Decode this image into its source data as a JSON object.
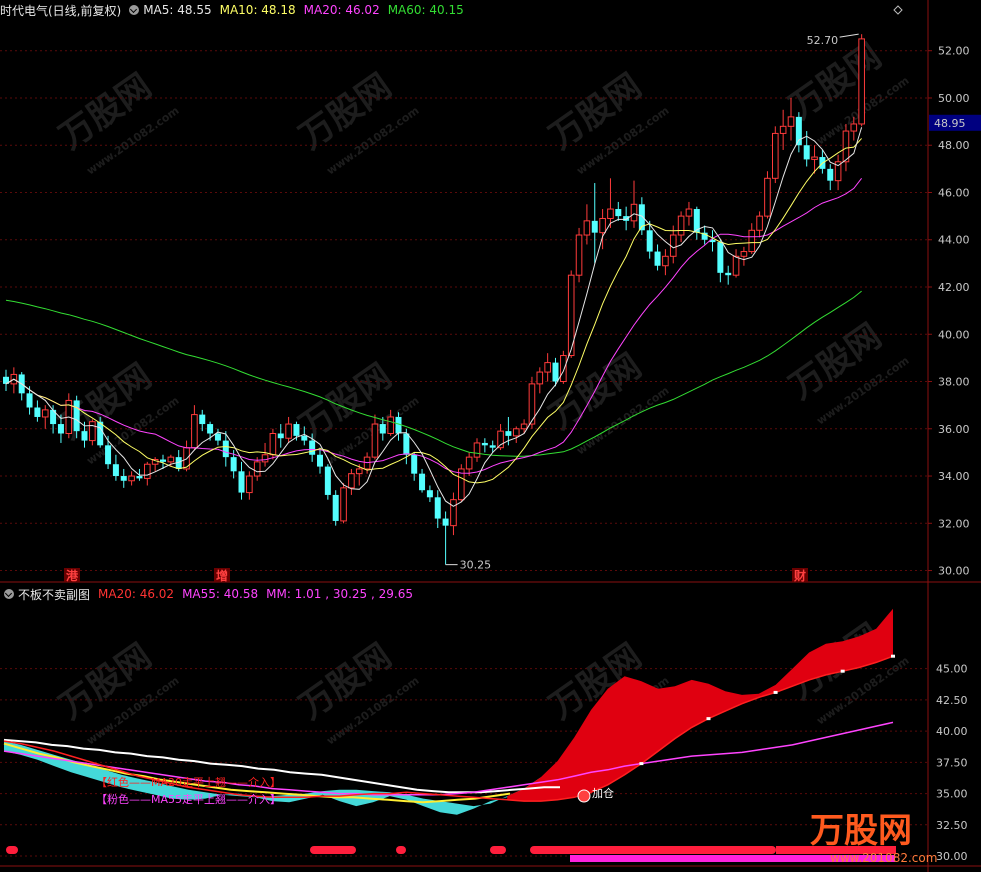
{
  "header": {
    "stock_name": "时代电气(日线,前复权)",
    "ma5": {
      "label": "MA5: 48.55",
      "color": "#e6e6e6"
    },
    "ma10": {
      "label": "MA10: 48.18",
      "color": "#ffff66"
    },
    "ma20": {
      "label": "MA20: 46.02",
      "color": "#ff44ff"
    },
    "ma60": {
      "label": "MA60: 40.15",
      "color": "#33dd33"
    },
    "icon": "chevron-down-circle-icon"
  },
  "sub_header": {
    "title": "不板不卖副图",
    "ma20": {
      "label": "MA20: 46.02",
      "color": "#ff3333"
    },
    "ma55": {
      "label": "MA55: 40.58",
      "color": "#ff44ff"
    },
    "mm": {
      "label": "MM: 1.01 , 30.25 , 29.65",
      "color": "#ff44ff"
    }
  },
  "chart_data": [
    {
      "type": "candlestick",
      "yticks": [
        30.0,
        32.0,
        34.0,
        36.0,
        38.0,
        40.0,
        42.0,
        44.0,
        46.0,
        48.0,
        50.0,
        52.0
      ],
      "ylim": [
        29.6,
        53.3
      ],
      "last_price_label": "48.95",
      "high_annotation": "52.70",
      "low_annotation": "30.25",
      "event_markers": [
        "港",
        "增",
        "财"
      ],
      "colors": {
        "up": "#ff3b3b",
        "down": "#54ffff"
      },
      "candles": [
        [
          38.2,
          38.5,
          37.6,
          37.9
        ],
        [
          37.9,
          38.6,
          37.5,
          38.3
        ],
        [
          38.3,
          38.4,
          37.2,
          37.5
        ],
        [
          37.5,
          37.8,
          36.6,
          36.9
        ],
        [
          36.9,
          37.2,
          36.3,
          36.5
        ],
        [
          36.5,
          37.0,
          36.0,
          36.8
        ],
        [
          36.8,
          37.0,
          35.8,
          36.2
        ],
        [
          36.2,
          36.6,
          35.4,
          35.8
        ],
        [
          35.8,
          37.5,
          35.6,
          37.2
        ],
        [
          37.2,
          37.4,
          35.6,
          35.9
        ],
        [
          35.9,
          36.3,
          35.2,
          35.5
        ],
        [
          35.5,
          36.4,
          35.3,
          36.3
        ],
        [
          36.3,
          36.5,
          35.2,
          35.3
        ],
        [
          35.3,
          35.7,
          34.3,
          34.5
        ],
        [
          34.5,
          34.9,
          33.8,
          34.0
        ],
        [
          34.0,
          34.3,
          33.5,
          33.8
        ],
        [
          33.8,
          34.2,
          33.6,
          34.0
        ],
        [
          34.0,
          34.3,
          33.8,
          33.9
        ],
        [
          33.9,
          34.6,
          33.6,
          34.5
        ],
        [
          34.5,
          34.8,
          34.2,
          34.7
        ],
        [
          34.7,
          34.9,
          34.3,
          34.6
        ],
        [
          34.6,
          34.9,
          34.4,
          34.8
        ],
        [
          34.8,
          35.1,
          34.2,
          34.3
        ],
        [
          34.3,
          35.5,
          34.2,
          35.2
        ],
        [
          35.2,
          37.0,
          35.1,
          36.6
        ],
        [
          36.6,
          36.8,
          35.9,
          36.2
        ],
        [
          36.2,
          36.3,
          35.5,
          35.8
        ],
        [
          35.8,
          36.0,
          35.3,
          35.5
        ],
        [
          35.5,
          35.9,
          34.4,
          34.8
        ],
        [
          34.8,
          35.1,
          33.9,
          34.2
        ],
        [
          34.2,
          34.6,
          33.0,
          33.3
        ],
        [
          33.3,
          34.2,
          33.0,
          34.0
        ],
        [
          34.0,
          34.8,
          33.8,
          34.6
        ],
        [
          34.6,
          35.4,
          34.4,
          34.9
        ],
        [
          34.9,
          36.0,
          34.7,
          35.8
        ],
        [
          35.8,
          36.2,
          35.2,
          35.6
        ],
        [
          35.6,
          36.5,
          35.4,
          36.2
        ],
        [
          36.2,
          36.3,
          35.5,
          35.7
        ],
        [
          35.7,
          36.1,
          35.3,
          35.5
        ],
        [
          35.5,
          35.8,
          34.6,
          34.9
        ],
        [
          34.9,
          35.2,
          34.1,
          34.4
        ],
        [
          34.4,
          34.5,
          33.0,
          33.2
        ],
        [
          33.2,
          33.4,
          31.9,
          32.1
        ],
        [
          32.1,
          33.7,
          32.0,
          33.5
        ],
        [
          33.5,
          34.3,
          33.2,
          34.1
        ],
        [
          34.1,
          34.5,
          33.6,
          34.3
        ],
        [
          34.3,
          35.0,
          34.1,
          34.8
        ],
        [
          34.8,
          36.6,
          34.7,
          36.2
        ],
        [
          36.2,
          36.5,
          35.5,
          35.8
        ],
        [
          35.8,
          36.8,
          35.7,
          36.5
        ],
        [
          36.5,
          36.7,
          35.5,
          35.8
        ],
        [
          35.8,
          36.0,
          34.5,
          34.9
        ],
        [
          34.9,
          35.0,
          33.8,
          34.1
        ],
        [
          34.1,
          34.3,
          33.3,
          33.4
        ],
        [
          33.4,
          33.6,
          32.9,
          33.1
        ],
        [
          33.1,
          33.4,
          31.8,
          32.2
        ],
        [
          32.2,
          32.5,
          30.25,
          31.9
        ],
        [
          31.9,
          33.3,
          31.5,
          33.0
        ],
        [
          33.0,
          34.5,
          32.9,
          34.3
        ],
        [
          34.3,
          35.0,
          34.0,
          34.8
        ],
        [
          34.8,
          35.6,
          34.6,
          35.4
        ],
        [
          35.4,
          35.6,
          35.0,
          35.3
        ],
        [
          35.3,
          35.5,
          35.0,
          35.2
        ],
        [
          35.2,
          36.2,
          35.1,
          35.9
        ],
        [
          35.9,
          36.5,
          35.3,
          35.7
        ],
        [
          35.7,
          36.1,
          35.4,
          36.0
        ],
        [
          36.0,
          36.4,
          35.8,
          36.2
        ],
        [
          36.2,
          38.2,
          36.0,
          37.9
        ],
        [
          37.9,
          38.6,
          37.5,
          38.4
        ],
        [
          38.4,
          39.2,
          38.0,
          38.8
        ],
        [
          38.8,
          39.0,
          37.8,
          38.0
        ],
        [
          38.0,
          39.3,
          37.9,
          39.1
        ],
        [
          39.1,
          42.7,
          39.0,
          42.5
        ],
        [
          42.5,
          44.5,
          42.2,
          44.2
        ],
        [
          44.2,
          45.5,
          43.8,
          44.8
        ],
        [
          44.8,
          46.4,
          43.0,
          44.3
        ],
        [
          44.3,
          45.3,
          43.6,
          44.9
        ],
        [
          44.9,
          46.6,
          44.5,
          45.3
        ],
        [
          45.3,
          45.6,
          44.8,
          45.0
        ],
        [
          45.0,
          45.4,
          44.4,
          44.8
        ],
        [
          44.8,
          46.5,
          44.5,
          45.5
        ],
        [
          45.5,
          45.8,
          44.2,
          44.4
        ],
        [
          44.4,
          44.8,
          43.2,
          43.5
        ],
        [
          43.5,
          43.8,
          42.7,
          42.9
        ],
        [
          42.9,
          43.6,
          42.5,
          43.3
        ],
        [
          43.3,
          44.6,
          43.0,
          44.2
        ],
        [
          44.2,
          45.2,
          43.9,
          45.0
        ],
        [
          45.0,
          45.6,
          44.6,
          45.3
        ],
        [
          45.3,
          45.4,
          44.0,
          44.3
        ],
        [
          44.3,
          44.6,
          43.8,
          44.0
        ],
        [
          44.0,
          44.4,
          43.5,
          43.9
        ],
        [
          43.9,
          44.0,
          42.2,
          42.6
        ],
        [
          42.6,
          42.9,
          42.1,
          42.5
        ],
        [
          42.5,
          43.6,
          42.4,
          43.3
        ],
        [
          43.3,
          43.7,
          42.9,
          43.5
        ],
        [
          43.5,
          44.7,
          43.4,
          44.4
        ],
        [
          44.4,
          45.2,
          44.1,
          45.0
        ],
        [
          45.0,
          46.9,
          44.9,
          46.6
        ],
        [
          46.6,
          48.8,
          46.4,
          48.5
        ],
        [
          48.5,
          49.5,
          47.8,
          48.8
        ],
        [
          48.8,
          50.0,
          48.2,
          49.2
        ],
        [
          49.2,
          49.4,
          47.7,
          48.0
        ],
        [
          48.0,
          48.6,
          47.1,
          47.4
        ],
        [
          47.4,
          48.0,
          46.8,
          47.5
        ],
        [
          47.5,
          47.8,
          46.8,
          47.0
        ],
        [
          47.0,
          47.2,
          46.1,
          46.5
        ],
        [
          46.5,
          47.6,
          46.1,
          47.3
        ],
        [
          47.3,
          48.9,
          46.9,
          48.6
        ],
        [
          48.6,
          49.2,
          48.2,
          48.9
        ],
        [
          48.9,
          52.7,
          48.8,
          52.5
        ]
      ]
    },
    {
      "type": "indicator",
      "yticks": [
        30.0,
        32.5,
        35.0,
        37.5,
        40.0,
        42.5,
        45.0
      ],
      "ylim": [
        29.2,
        50.5
      ],
      "legend_lines": [
        "【红色——MA20走平上翘——介入】",
        "【粉色——MA55走平上翘——介入】"
      ],
      "annotation": "加仓",
      "ma20": [
        39.2,
        39.0,
        38.7,
        38.4,
        38.0,
        37.6,
        37.2,
        36.8,
        36.4,
        36.1,
        35.8,
        35.5,
        35.3,
        35.1,
        34.9,
        34.8,
        34.7,
        34.7,
        34.7,
        34.8,
        34.8,
        34.9,
        35.0,
        35.0,
        35.1,
        35.0,
        34.9,
        34.8,
        34.7,
        34.6,
        34.5,
        34.4,
        34.4,
        34.5,
        34.7,
        35.1,
        35.7,
        36.5,
        37.4,
        38.4,
        39.4,
        40.3,
        41.0,
        41.6,
        42.2,
        42.7,
        43.1,
        43.6,
        44.1,
        44.5,
        44.8,
        45.1,
        45.5,
        46.0
      ],
      "ma20_band_top": [
        39.2,
        38.9,
        38.5,
        38.1,
        37.7,
        37.3,
        36.9,
        36.5,
        36.2,
        35.9,
        35.6,
        35.3,
        35.1,
        34.9,
        34.8,
        34.7,
        34.8,
        34.9,
        35.0,
        35.2,
        35.3,
        35.3,
        35.2,
        35.1,
        34.9,
        34.6,
        34.4,
        34.2,
        34.0,
        34.2,
        34.8,
        35.4,
        36.3,
        37.6,
        39.5,
        41.7,
        43.4,
        44.4,
        44.0,
        43.4,
        43.6,
        44.1,
        43.8,
        43.2,
        42.9,
        43.0,
        43.7,
        45.0,
        46.3,
        47.0,
        47.2,
        47.6,
        48.2,
        49.8
      ],
      "ma55": [
        38.4,
        38.2,
        38.0,
        37.8,
        37.6,
        37.4,
        37.2,
        37.0,
        36.8,
        36.6,
        36.4,
        36.2,
        36.0,
        35.9,
        35.7,
        35.6,
        35.4,
        35.3,
        35.2,
        35.1,
        35.0,
        35.0,
        34.9,
        34.9,
        34.9,
        34.9,
        34.9,
        35.0,
        35.1,
        35.3,
        35.5,
        35.7,
        35.9,
        36.1,
        36.4,
        36.7,
        36.9,
        37.2,
        37.4,
        37.6,
        37.8,
        38.0,
        38.1,
        38.2,
        38.3,
        38.5,
        38.7,
        38.9,
        39.2,
        39.5,
        39.8,
        40.1,
        40.4,
        40.7
      ],
      "white": [
        39.3,
        39.2,
        39.1,
        38.9,
        38.8,
        38.6,
        38.5,
        38.3,
        38.2,
        38.0,
        37.9,
        37.7,
        37.6,
        37.4,
        37.3,
        37.2,
        37.0,
        36.9,
        36.7,
        36.6,
        36.5,
        36.3,
        36.1,
        35.9,
        35.7,
        35.5,
        35.3,
        35.2,
        35.1,
        35.1,
        35.1,
        35.2,
        35.3,
        35.4,
        35.5,
        35.5
      ],
      "yellow": [
        39.0,
        38.6,
        38.2,
        37.9,
        37.5,
        37.2,
        36.9,
        36.6,
        36.4,
        36.1,
        35.9,
        35.7,
        35.5,
        35.3,
        35.2,
        35.1,
        35.0,
        34.9,
        34.8,
        34.7,
        34.7,
        34.6,
        34.5,
        34.4,
        34.3,
        34.4,
        34.5,
        34.6,
        34.8,
        35.0
      ],
      "cyan_band_bottom": [
        38.4,
        38.1,
        37.7,
        37.2,
        36.7,
        36.3,
        35.9,
        35.5,
        35.2,
        34.9,
        34.6,
        34.5,
        34.6,
        34.9,
        35.0,
        34.7,
        34.4,
        34.3,
        34.6,
        34.9,
        34.4,
        34.0,
        34.3,
        34.8,
        34.5,
        34.0,
        33.5,
        33.3,
        33.8,
        34.4,
        34.7,
        34.9,
        35.1
      ],
      "bottom_bars": {
        "red": "#ff1e3c",
        "magenta": "#ff22dd"
      }
    }
  ],
  "watermark": {
    "brand": "万股网",
    "site": "www.201082.com"
  }
}
